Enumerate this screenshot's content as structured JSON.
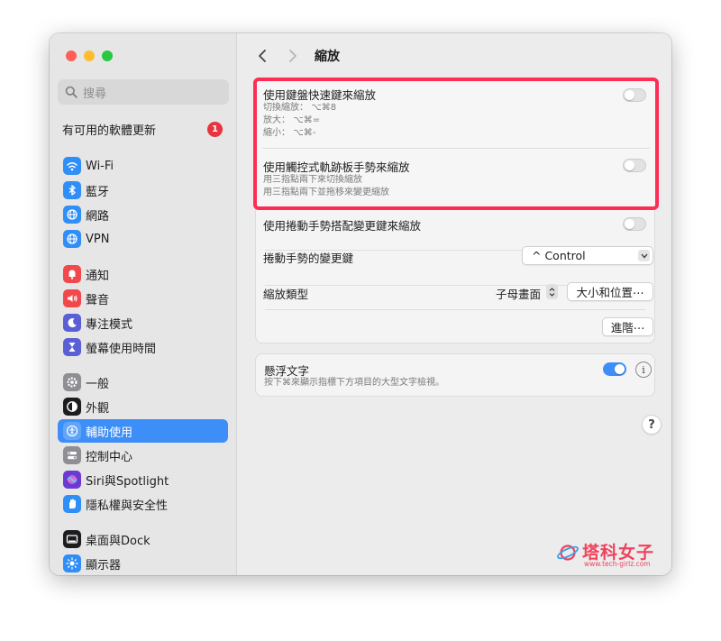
{
  "sidebar": {
    "search_placeholder": "搜尋",
    "update": {
      "label": "有可用的軟體更新",
      "badge": "1"
    },
    "items": [
      {
        "label": "Wi-Fi",
        "icon": "wifi-icon",
        "color": "#2f8ff7"
      },
      {
        "label": "藍牙",
        "icon": "bluetooth-icon",
        "color": "#2f8ff7"
      },
      {
        "label": "網路",
        "icon": "globe-icon",
        "color": "#2f8ff7"
      },
      {
        "label": "VPN",
        "icon": "vpn-globe-icon",
        "color": "#2f8ff7"
      },
      {
        "label": "通知",
        "icon": "bell-icon",
        "color": "#f2484b"
      },
      {
        "label": "聲音",
        "icon": "speaker-icon",
        "color": "#f2484b"
      },
      {
        "label": "專注模式",
        "icon": "moon-icon",
        "color": "#5b5fd6"
      },
      {
        "label": "螢幕使用時間",
        "icon": "hourglass-icon",
        "color": "#5b5fd6"
      },
      {
        "label": "一般",
        "icon": "gear-icon",
        "color": "#8e8e93"
      },
      {
        "label": "外觀",
        "icon": "appearance-icon",
        "color": "#1d1d1f"
      },
      {
        "label": "輔助使用",
        "icon": "accessibility-icon",
        "color": "#2f8ff7"
      },
      {
        "label": "控制中心",
        "icon": "control-center-icon",
        "color": "#8e8e93"
      },
      {
        "label": "Siri與Spotlight",
        "icon": "siri-icon",
        "color": "#6a3bd1"
      },
      {
        "label": "隱私權與安全性",
        "icon": "hand-icon",
        "color": "#2f8ff7"
      },
      {
        "label": "桌面與Dock",
        "icon": "dock-icon",
        "color": "#1d1d1f"
      },
      {
        "label": "顯示器",
        "icon": "sun-icon",
        "color": "#2f8ff7"
      }
    ],
    "selected_index": 10
  },
  "toolbar": {
    "title": "縮放"
  },
  "zoom": {
    "keyboard": {
      "title": "使用鍵盤快速鍵來縮放",
      "lines": [
        "切換縮放： ⌥⌘8",
        "放大： ⌥⌘=",
        "縮小： ⌥⌘-"
      ],
      "enabled": false
    },
    "trackpad": {
      "title": "使用觸控式軌跡板手勢來縮放",
      "lines": [
        "用三指點兩下來切換縮放",
        "用三指點兩下並拖移來變更縮放"
      ],
      "enabled": false
    },
    "scroll": {
      "title": "使用捲動手勢搭配變更鍵來縮放",
      "enabled": false
    },
    "modifier": {
      "label": "捲動手勢的變更鍵",
      "value": "^ Control"
    },
    "style": {
      "label": "縮放類型",
      "value": "子母畫面",
      "button": "大小和位置⋯"
    },
    "advanced_button": "進階⋯"
  },
  "hover_text": {
    "title": "懸浮文字",
    "subtitle": "按下⌘來顯示指標下方項目的大型文字檢視。",
    "enabled": true
  },
  "help": "?",
  "info": "i",
  "watermark": {
    "text": "塔科女子",
    "url": "www.tech-girlz.com"
  },
  "colors": {
    "accent": "#3e8ef7",
    "highlight": "#ff2d55",
    "watermark": "#f0415c"
  }
}
